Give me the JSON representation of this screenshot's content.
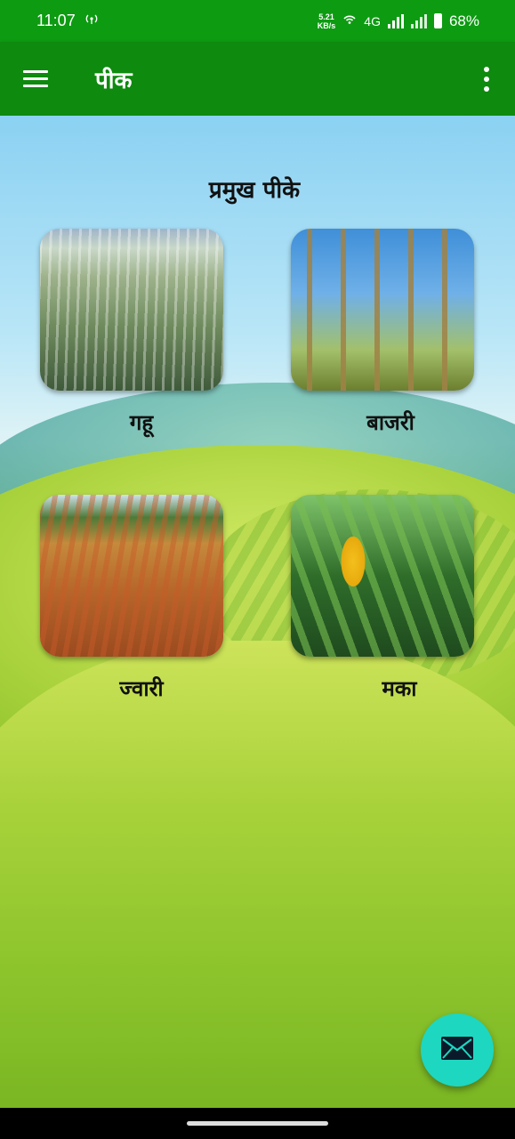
{
  "status_bar": {
    "time": "11:07",
    "net_speed_value": "5.21",
    "net_speed_unit": "KB/s",
    "network_type": "4G",
    "battery_percent": "68%",
    "icons": [
      "hotspot-icon",
      "wifi-icon",
      "signal-icon",
      "battery-icon"
    ]
  },
  "app_bar": {
    "title": "पीक",
    "icons": [
      "hamburger-menu-icon",
      "more-vert-icon"
    ]
  },
  "main": {
    "section_title": "प्रमुख पीके",
    "crops": [
      {
        "label": "गहू",
        "image": "wheat-field-image"
      },
      {
        "label": "बाजरी",
        "image": "pearl-millet-image"
      },
      {
        "label": "ज्वारी",
        "image": "sorghum-field-image"
      },
      {
        "label": "मका",
        "image": "maize-corn-image"
      }
    ]
  },
  "fab": {
    "icon": "mail-icon",
    "color": "#1dd7c1"
  },
  "colors": {
    "status_bar": "#0d9b12",
    "app_bar": "#0e8a0f"
  }
}
